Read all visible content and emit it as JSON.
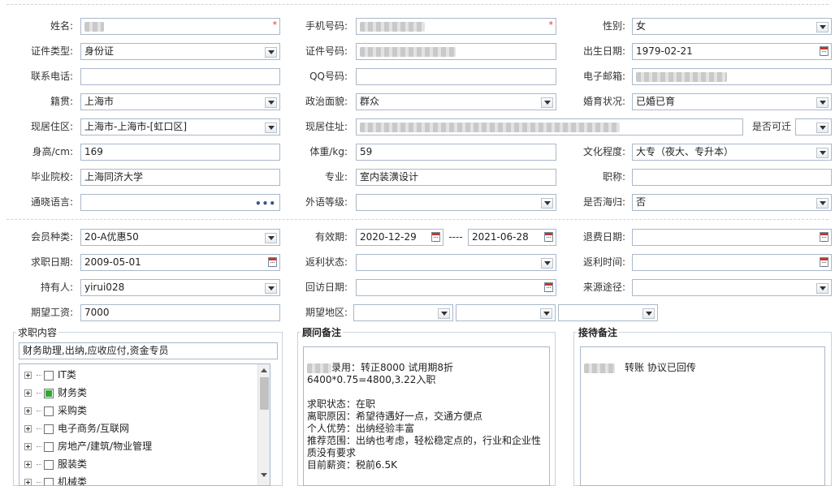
{
  "personal": {
    "name_label": "姓名:",
    "phone_label": "手机号码:",
    "gender_label": "性别:",
    "gender_value": "女",
    "id_type_label": "证件类型:",
    "id_type_value": "身份证",
    "id_number_label": "证件号码:",
    "birth_label": "出生日期:",
    "birth_value": "1979-02-21",
    "contact_label": "联系电话:",
    "qq_label": "QQ号码:",
    "email_label": "电子邮箱:",
    "native_label": "籍贯:",
    "native_value": "上海市",
    "political_label": "政治面貌:",
    "political_value": "群众",
    "marital_label": "婚育状况:",
    "marital_value": "已婚已育",
    "residence_label": "现居住区:",
    "residence_value": "上海市-上海市-[虹口区]",
    "address_label": "现居住址:",
    "relocate_label": "是否可迁",
    "height_label": "身高/cm:",
    "height_value": "169",
    "weight_label": "体重/kg:",
    "weight_value": "59",
    "education_label": "文化程度:",
    "education_value": "大专（夜大、专升本）",
    "school_label": "毕业院校:",
    "school_value": "上海同济大学",
    "major_label": "专业:",
    "major_value": "室内装潢设计",
    "title_label": "职称:",
    "language_label": "通晓语言:",
    "foreign_label": "外语等级:",
    "overseas_label": "是否海归:",
    "overseas_value": "否"
  },
  "membership": {
    "type_label": "会员种类:",
    "type_value": "20-A优惠50",
    "valid_label": "有效期:",
    "valid_from": "2020-12-29",
    "valid_sep": "----",
    "valid_to": "2021-06-28",
    "refund_date_label": "退费日期:",
    "job_date_label": "求职日期:",
    "job_date_value": "2009-05-01",
    "rebate_status_label": "返利状态:",
    "rebate_time_label": "返利时间:",
    "holder_label": "持有人:",
    "holder_value": "yirui028",
    "visit_date_label": "回访日期:",
    "source_label": "来源途径:",
    "salary_label": "期望工资:",
    "salary_value": "7000",
    "area_label": "期望地区:"
  },
  "job_content": {
    "title": "求职内容",
    "summary": "财务助理,出纳,应收应付,资金专员",
    "categories": [
      {
        "label": "IT类",
        "checked": false
      },
      {
        "label": "财务类",
        "checked": true
      },
      {
        "label": "采购类",
        "checked": false
      },
      {
        "label": "电子商务/互联网",
        "checked": false
      },
      {
        "label": "房地产/建筑/物业管理",
        "checked": false
      },
      {
        "label": "服装类",
        "checked": false
      },
      {
        "label": "机械类",
        "checked": false
      }
    ]
  },
  "consultant_notes": {
    "title": "顾问备注",
    "line1": "录用：转正8000 试用期8折6400*0.75=4800,3.22入职",
    "line2": "",
    "line3": "求职状态：在职",
    "line4": "离职原因：希望待遇好一点，交通方便点",
    "line5": "个人优势：出纳经验丰富",
    "line6": "推荐范围：出纳也考虑，轻松稳定点的，行业和企业性质没有要求",
    "line7": "目前薪资：税前6.5K"
  },
  "reception_notes": {
    "title": "接待备注",
    "text": "转账 协议已回传"
  },
  "colors": {
    "border": "#a9b8c9",
    "required": "#e0322b",
    "checked": "#2faa2f",
    "section_border": "#c9d2dc"
  }
}
